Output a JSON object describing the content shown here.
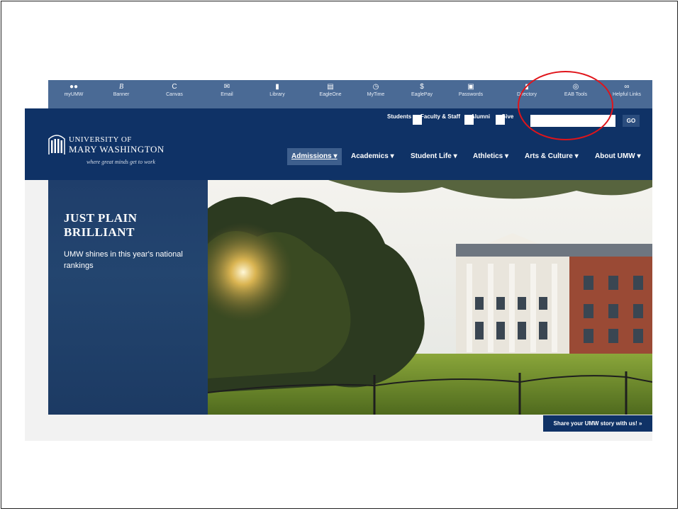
{
  "utility_bar": {
    "items": [
      {
        "label": "myUMW",
        "icon": "people-icon"
      },
      {
        "label": "Banner",
        "icon": "banner-icon"
      },
      {
        "label": "Canvas",
        "icon": "canvas-icon"
      },
      {
        "label": "Email",
        "icon": "envelope-icon"
      },
      {
        "label": "Library",
        "icon": "book-icon"
      },
      {
        "label": "EagleOne",
        "icon": "card-icon"
      },
      {
        "label": "MyTime",
        "icon": "clock-icon"
      },
      {
        "label": "EaglePay",
        "icon": "dollar-icon"
      },
      {
        "label": "Passwords",
        "icon": "lock-icon"
      },
      {
        "label": "Directory",
        "icon": "book-icon"
      },
      {
        "label": "EAB Tools",
        "icon": "target-icon"
      },
      {
        "label": "Helpful Links",
        "icon": "link-icon"
      }
    ]
  },
  "quick_links": [
    "Students",
    "Faculty & Staff",
    "Alumni",
    "Give"
  ],
  "search": {
    "value": "",
    "go_label": "GO"
  },
  "logo": {
    "line1": "UNIVERSITY OF",
    "line2": "MARY WASHINGTON",
    "tagline": "where great minds get to work"
  },
  "nav": [
    {
      "label": "Admissions",
      "active": true
    },
    {
      "label": "Academics",
      "active": false
    },
    {
      "label": "Student Life",
      "active": false
    },
    {
      "label": "Athletics",
      "active": false
    },
    {
      "label": "Arts & Culture",
      "active": false
    },
    {
      "label": "About UMW",
      "active": false
    }
  ],
  "hero": {
    "title": "JUST PLAIN BRILLIANT",
    "subtitle": "UMW shines in this year's national rankings",
    "cta": "Share your UMW story with us! »"
  },
  "colors": {
    "header": "#0f3266",
    "topbar": "#4a6a95",
    "highlight_circle": "#e0141a"
  }
}
